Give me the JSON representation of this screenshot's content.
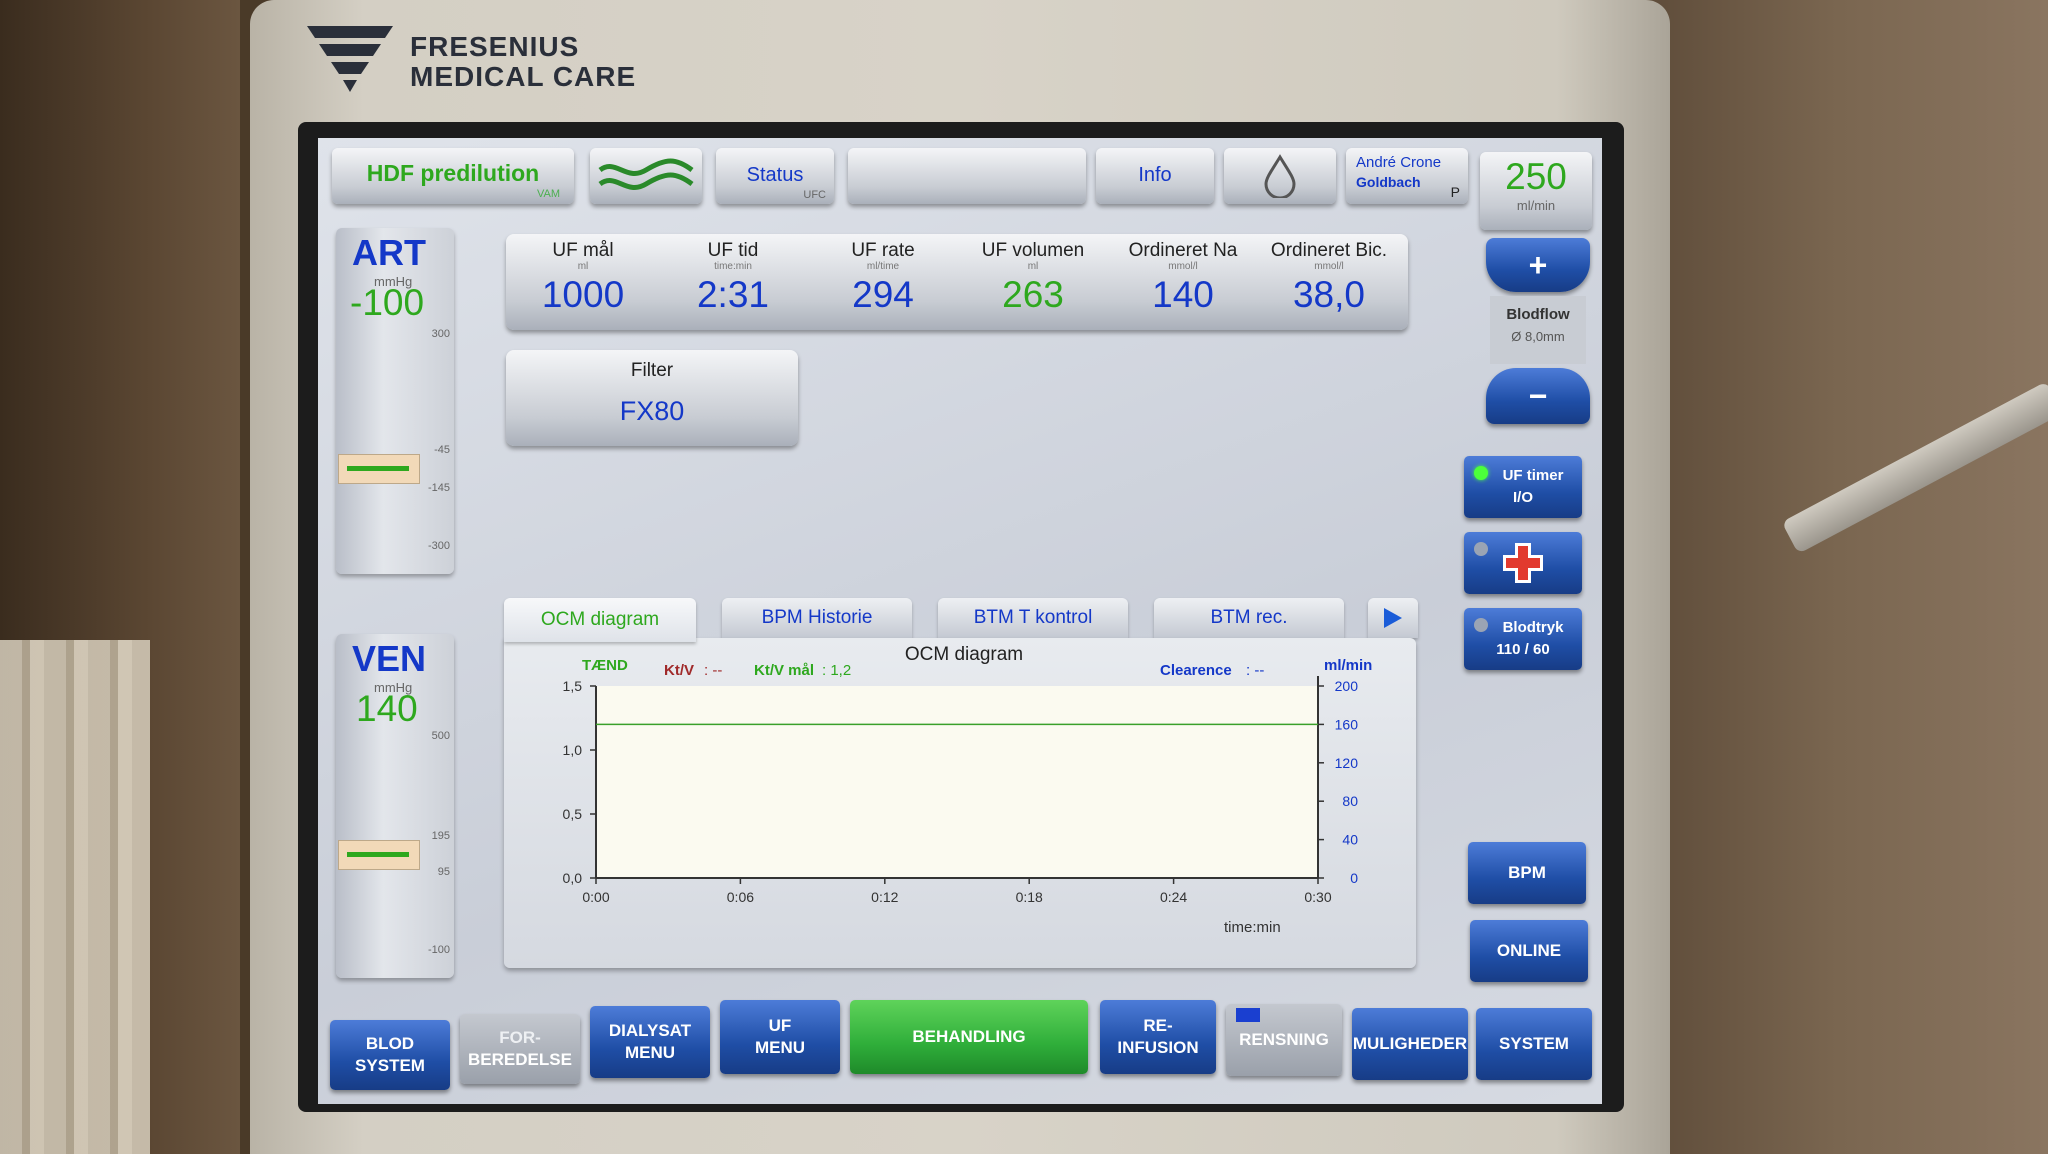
{
  "brand": {
    "line1": "FRESENIUS",
    "line2": "MEDICAL CARE"
  },
  "topbar": {
    "mode_label": "HDF predilution",
    "mode_sub": "VAM",
    "status_label": "Status",
    "status_sub": "UFC",
    "info_label": "Info",
    "user_line1": "André Crone",
    "user_line2": "Goldbach",
    "user_flag": "P"
  },
  "bloodflow": {
    "value": "250",
    "unit": "ml/min",
    "label": "Blodflow",
    "size": "Ø 8,0mm",
    "plus": "+",
    "minus": "−"
  },
  "art": {
    "title": "ART",
    "unit": "mmHg",
    "value": "-100",
    "scale": [
      "300",
      "-45",
      "-145",
      "-300"
    ]
  },
  "ven": {
    "title": "VEN",
    "unit": "mmHg",
    "value": "140",
    "scale": [
      "500",
      "195",
      "95",
      "-100"
    ]
  },
  "params": [
    {
      "label": "UF mål",
      "unit": "ml",
      "value": "1000",
      "color": "#1438c8"
    },
    {
      "label": "UF tid",
      "unit": "time:min",
      "value": "2:31",
      "color": "#1438c8"
    },
    {
      "label": "UF rate",
      "unit": "ml/time",
      "value": "294",
      "color": "#1438c8"
    },
    {
      "label": "UF volumen",
      "unit": "ml",
      "value": "263",
      "color": "#2ea81e"
    },
    {
      "label": "Ordineret Na",
      "unit": "mmol/l",
      "value": "140",
      "color": "#1438c8"
    },
    {
      "label": "Ordineret Bic.",
      "unit": "mmol/l",
      "value": "38,0",
      "color": "#1438c8"
    }
  ],
  "filter": {
    "label": "Filter",
    "value": "FX80"
  },
  "tabs": [
    "OCM diagram",
    "BPM Historie",
    "BTM T kontrol",
    "BTM rec."
  ],
  "chart_data": {
    "type": "line",
    "title": "OCM diagram",
    "status": "TÆND",
    "ktv_label": "Kt/V",
    "ktv_value": ": --",
    "ktv_target_label": "Kt/V mål",
    "ktv_target_value": ": 1,2",
    "clearance_label": "Clearence",
    "clearance_value": ": --",
    "x_ticks": [
      "0:00",
      "0:06",
      "0:12",
      "0:18",
      "0:24",
      "0:30"
    ],
    "xlabel": "time:min",
    "y_left_ticks": [
      "0,0",
      "0,5",
      "1,0",
      "1,5"
    ],
    "ylim_left": [
      0,
      1.5
    ],
    "y_right_ticks": [
      "0",
      "40",
      "80",
      "120",
      "160",
      "200"
    ],
    "ylim_right": [
      0,
      200
    ],
    "y_right_label": "ml/min",
    "series": [
      {
        "name": "Kt/V mål",
        "x": [
          0,
          30
        ],
        "y": [
          1.2,
          1.2
        ]
      }
    ],
    "grid": false
  },
  "side_buttons": {
    "uf_timer": "UF timer",
    "uf_timer_sub": "I/O",
    "bp": "Blodtryk",
    "bp_value": "110 / 60",
    "bpm": "BPM",
    "online": "ONLINE"
  },
  "bottom_nav": [
    {
      "line1": "BLOD",
      "line2": "SYSTEM",
      "style": "blue"
    },
    {
      "line1": "FOR-",
      "line2": "BEREDELSE",
      "style": "grey"
    },
    {
      "line1": "DIALYSAT",
      "line2": "MENU",
      "style": "blue"
    },
    {
      "line1": "UF",
      "line2": "MENU",
      "style": "blue"
    },
    {
      "line1": "BEHANDLING",
      "line2": "",
      "style": "green"
    },
    {
      "line1": "RE-",
      "line2": "INFUSION",
      "style": "blue"
    },
    {
      "line1": "RENSNING",
      "line2": "",
      "style": "grey"
    },
    {
      "line1": "MULIGHEDER",
      "line2": "",
      "style": "blue"
    },
    {
      "line1": "SYSTEM",
      "line2": "",
      "style": "blue"
    }
  ],
  "colors": {
    "accent_blue": "#1438c8",
    "value_green": "#2ea81e",
    "active_green": "#2fae3a",
    "nav_blue": "#1f4ea6"
  }
}
